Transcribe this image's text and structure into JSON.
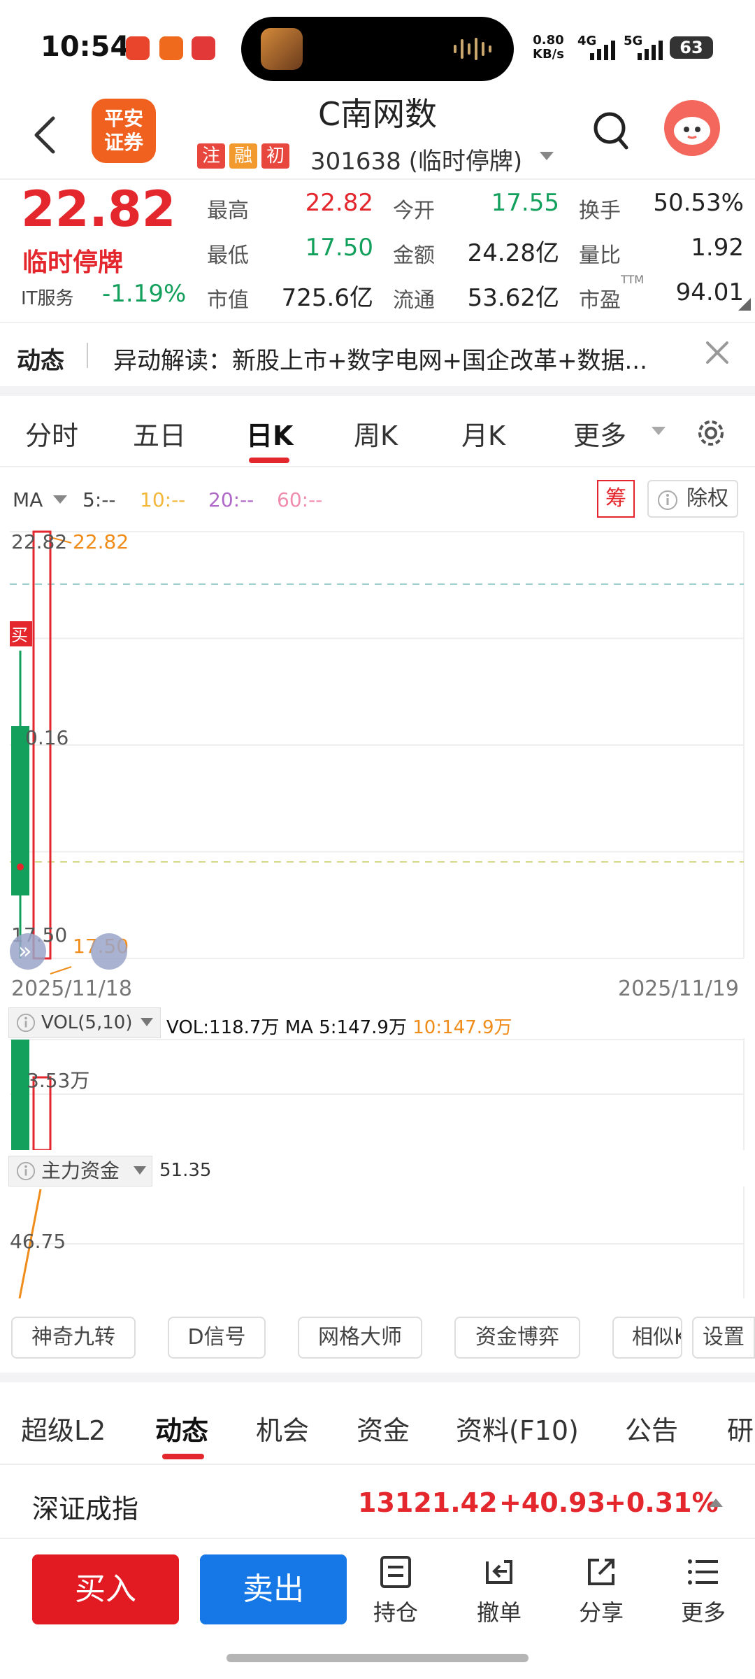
{
  "status_bar": {
    "time": "10:54",
    "net_speed_value": "0.80",
    "net_speed_unit": "KB/s",
    "signal1": "4G",
    "signal2": "5G",
    "battery": "63"
  },
  "header": {
    "stock_name": "C南网数",
    "broker_logo_line1": "平安",
    "broker_logo_line2": "证券",
    "tags": [
      {
        "label": "注",
        "color": "#e8473e"
      },
      {
        "label": "融",
        "color": "#f29a2e"
      },
      {
        "label": "初",
        "color": "#e8473e"
      }
    ],
    "stock_code_status": "301638 (临时停牌)"
  },
  "quote": {
    "last_price": "22.82",
    "status": "临时停牌",
    "sector": "IT服务",
    "sector_change": "-1.19%",
    "fields": [
      {
        "label": "最高",
        "value": "22.82",
        "color": "red"
      },
      {
        "label": "今开",
        "value": "17.55",
        "color": "green"
      },
      {
        "label": "换手",
        "value": "50.53%",
        "color": "black"
      },
      {
        "label": "最低",
        "value": "17.50",
        "color": "green"
      },
      {
        "label": "金额",
        "value": "24.28亿",
        "color": "black"
      },
      {
        "label": "量比",
        "value": "1.92",
        "color": "black"
      },
      {
        "label": "市值",
        "value": "725.6亿",
        "color": "black"
      },
      {
        "label": "流通",
        "value": "53.62亿",
        "color": "black"
      },
      {
        "label": "市盈",
        "value": "94.01",
        "color": "black"
      }
    ],
    "pe_superscript": "TTM"
  },
  "news": {
    "title": "动态",
    "text": "异动解读：新股上市+数字电网+国企改革+数据..."
  },
  "chart_tabs": [
    "分时",
    "五日",
    "日K",
    "周K",
    "月K",
    "更多"
  ],
  "chart_tabs_active": "日K",
  "ma_row": {
    "label": "MA",
    "ma5": "5:--",
    "ma10": "10:--",
    "ma20": "20:--",
    "ma60": "60:--",
    "colors": {
      "ma5": "#444444",
      "ma10": "#f2b73b",
      "ma20": "#b068c8",
      "ma60": "#f08cae"
    },
    "chip_button": "筹",
    "adjust_button": "除权"
  },
  "chart_data": {
    "type": "candlestick",
    "categories": [
      "2025/11/18"
    ],
    "ohlc": [
      {
        "open": 17.55,
        "high": 22.82,
        "low": 17.5,
        "close": 22.82
      }
    ],
    "y_ticks": [
      "22.82",
      "20.16",
      "17.50"
    ],
    "ylim": [
      17.5,
      22.82
    ],
    "high_label": "22.82",
    "low_label": "17.50",
    "buy_marker": "买",
    "date_start": "2025/11/18",
    "date_end": "2025/11/19"
  },
  "volume": {
    "label": "VOL(5,10)",
    "vol_text": "VOL:118.7万",
    "ma5_text": "MA 5:147.9万",
    "ma10_text": "10:147.9万",
    "axis_label": "3.53万"
  },
  "main_fund": {
    "label": "主力资金",
    "value": "51.35",
    "axis_label": "46.75"
  },
  "tool_buttons": [
    "神奇九转",
    "D信号",
    "网格大师",
    "资金博弈",
    "相似K",
    "设置"
  ],
  "info_tabs": [
    "超级L2",
    "动态",
    "机会",
    "资金",
    "资料(F10)",
    "公告",
    "研"
  ],
  "info_tabs_active": "动态",
  "index": {
    "name": "深证成指",
    "value": "13121.42",
    "change": "+40.93",
    "pct": "+0.31%"
  },
  "bottom_bar": {
    "buy": "买入",
    "sell": "卖出",
    "items": [
      "持仓",
      "撤单",
      "分享",
      "更多"
    ]
  }
}
